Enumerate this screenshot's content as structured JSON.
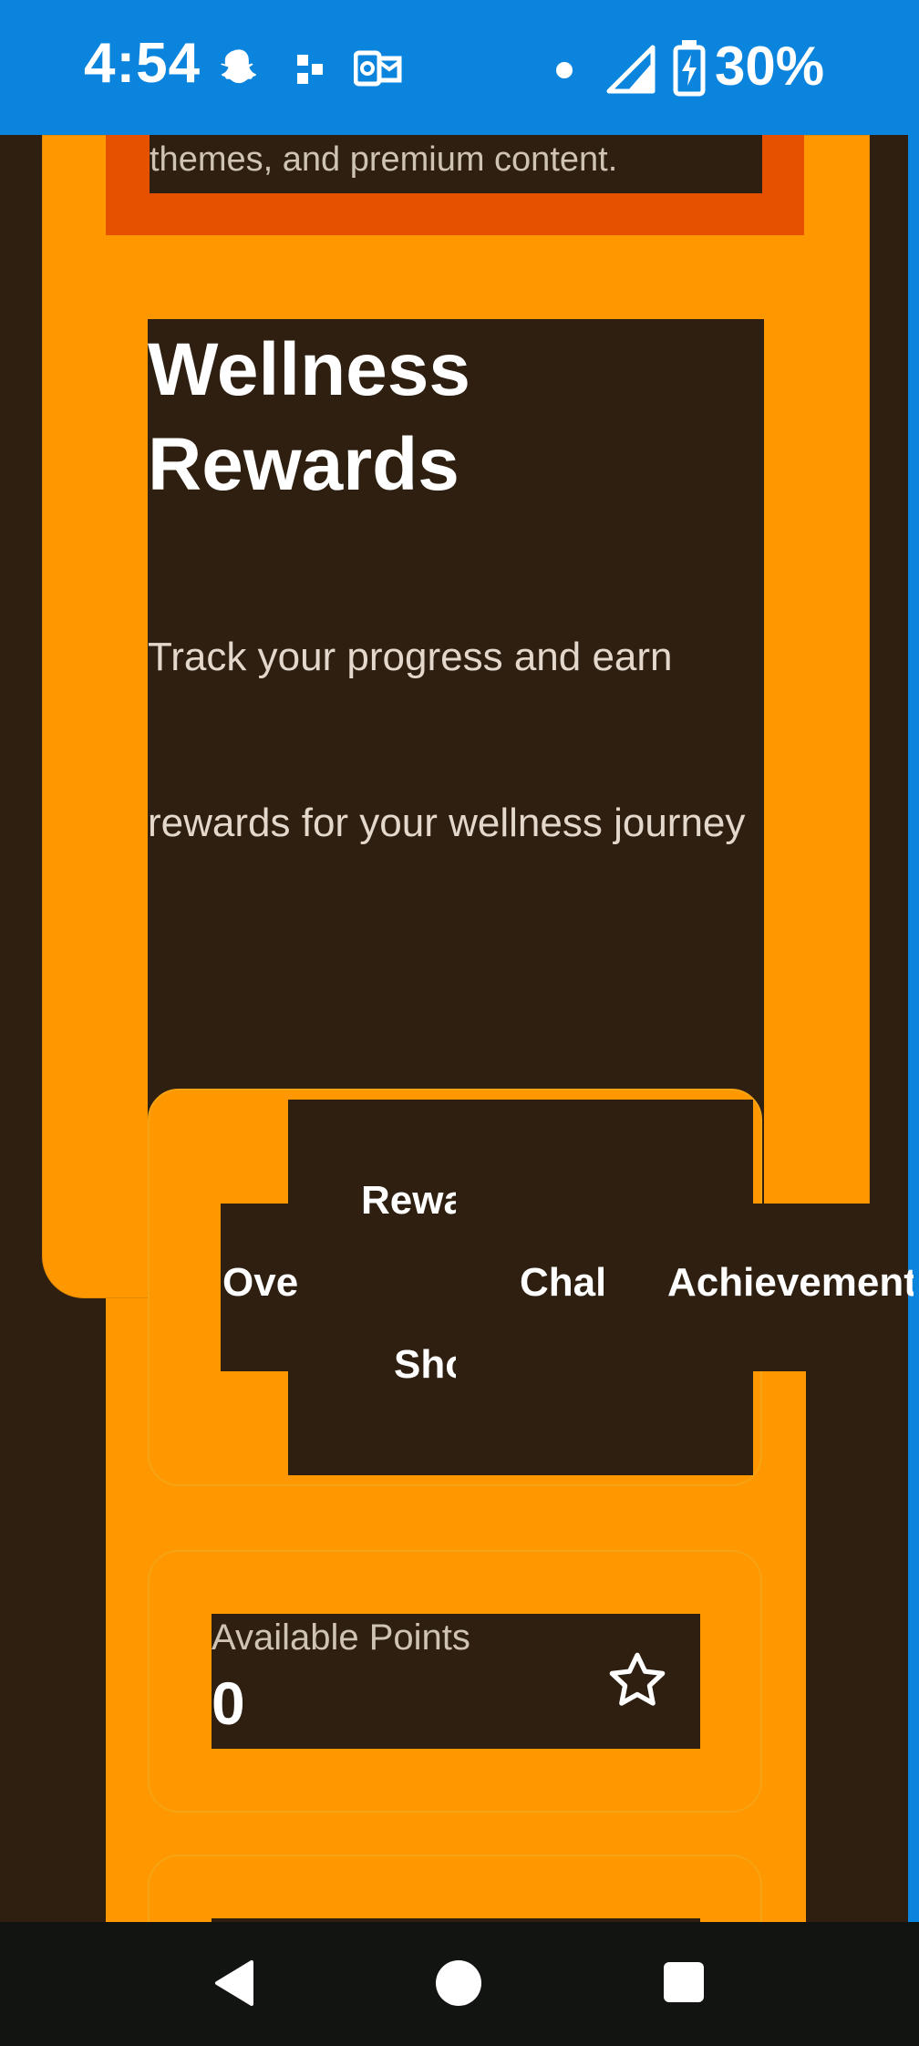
{
  "status_bar": {
    "time": "4:54",
    "battery_percent": "30%",
    "icons": [
      "snapchat-icon",
      "slack-icon",
      "outlook-icon",
      "dot-icon",
      "cellular-signal-icon",
      "battery-charging-icon"
    ]
  },
  "banner": {
    "text": "themes, and premium content."
  },
  "hero": {
    "title": "Wellness Rewards",
    "subtitle": "Track your progress and earn rewards for your wellness journey"
  },
  "tabs": {
    "items": [
      {
        "label": "Overview"
      },
      {
        "label": "Rewards"
      },
      {
        "label": "Shop"
      },
      {
        "label": "Challenges"
      },
      {
        "label": "Achievements"
      }
    ]
  },
  "points_card": {
    "label": "Available Points",
    "value": "0",
    "icon": "star-icon"
  },
  "nav": {
    "buttons": [
      "back-icon",
      "home-icon",
      "recents-icon"
    ]
  },
  "colors": {
    "status_bar_bg": "#0b84de",
    "page_bg": "#2e1f10",
    "accent_orange": "#ff9800",
    "deep_orange": "#e65100",
    "nav_bg": "#121411"
  }
}
